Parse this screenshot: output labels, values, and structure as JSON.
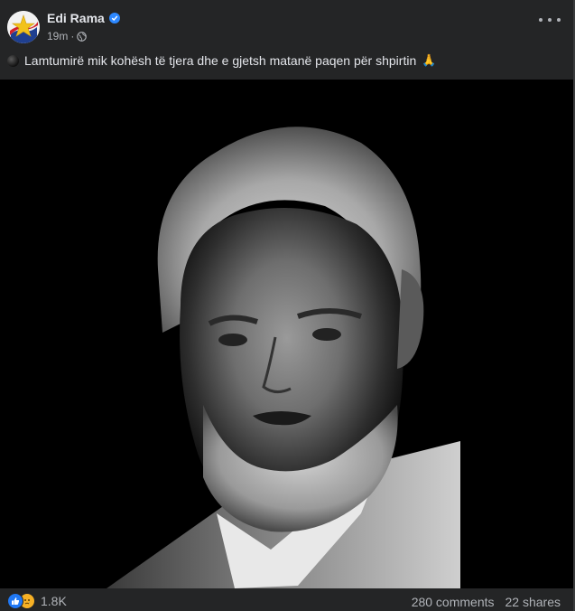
{
  "post": {
    "author_name": "Edi Rama",
    "verified": true,
    "time_ago": "19m",
    "separator": "·",
    "audience_icon": "globe-icon",
    "caption_emoji_start": "black-circle-icon",
    "caption": "Lamtumirë mik kohësh të tjera dhe e gjetsh matanë paqen për shpirtin",
    "caption_emoji_end": "🙏",
    "photo_subject": "portrait-photo"
  },
  "footer": {
    "reaction_icons": [
      "like-icon",
      "sad-icon"
    ],
    "reaction_count": "1.8K",
    "comments": "280 comments",
    "shares": "22 shares"
  },
  "colors": {
    "background": "#242526",
    "text_primary": "#e4e6eb",
    "text_secondary": "#b0b3b8",
    "verified_blue": "#2d88ff",
    "like_blue": "#2078f4",
    "sad_yellow": "#f7b125"
  }
}
